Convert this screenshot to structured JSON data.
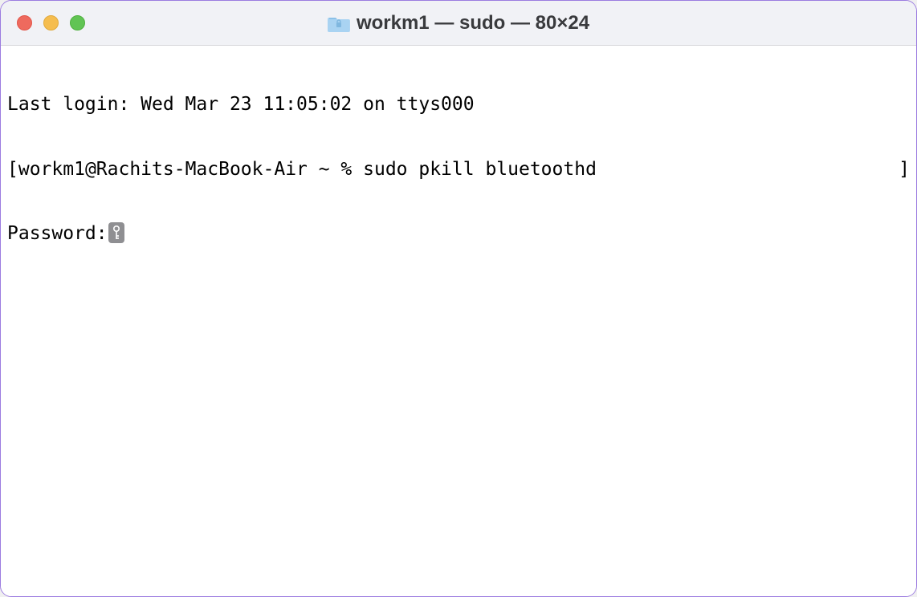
{
  "window": {
    "title": "workm1 — sudo — 80×24"
  },
  "terminal": {
    "last_login": "Last login: Wed Mar 23 11:05:02 on ttys000",
    "prompt_left_bracket": "[",
    "prompt": "workm1@Rachits-MacBook-Air ~ % ",
    "command": "sudo pkill bluetoothd",
    "prompt_right_bracket": "]",
    "password_label": "Password:"
  }
}
